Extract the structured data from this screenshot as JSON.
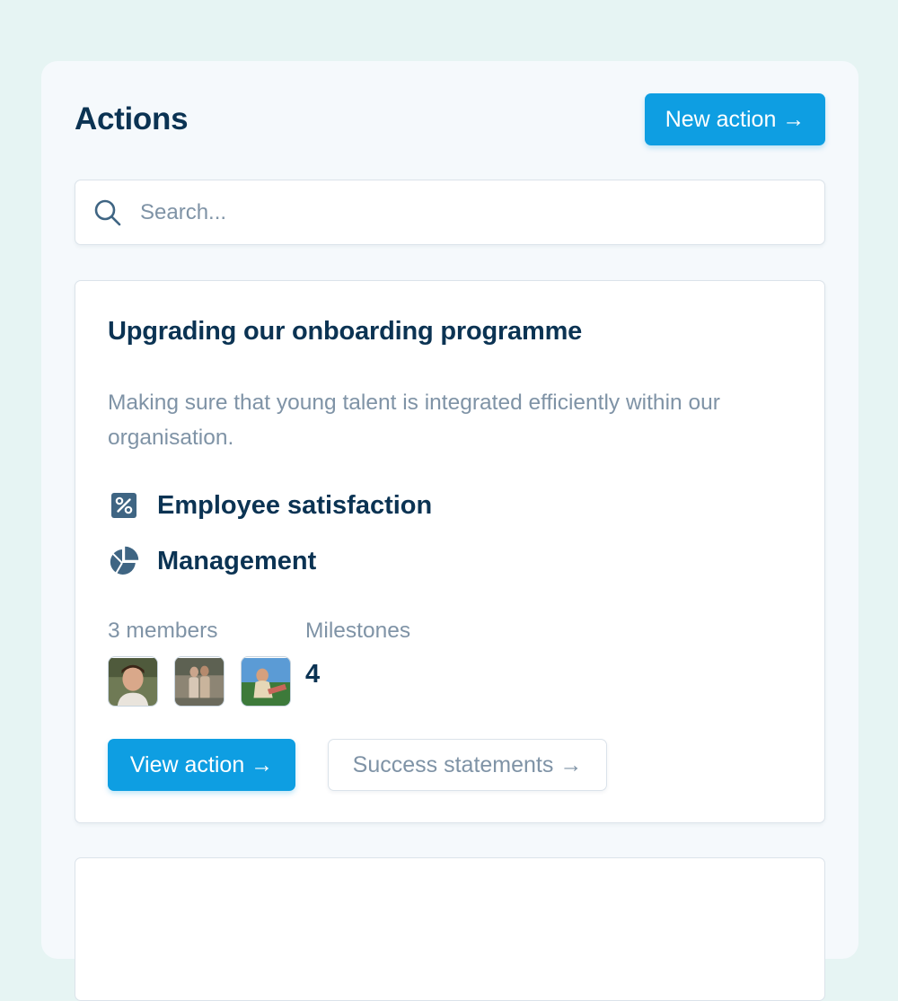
{
  "header": {
    "title": "Actions",
    "new_action_label": "New action →"
  },
  "search": {
    "placeholder": "Search..."
  },
  "action_card": {
    "title": "Upgrading our onboarding programme",
    "description": "Making sure that young talent is integrated efficiently within our organisation.",
    "tags": [
      {
        "label": "Employee satisfaction",
        "icon": "percent-square-icon"
      },
      {
        "label": "Management",
        "icon": "pie-chart-icon"
      }
    ],
    "members_label": "3 members",
    "members": [
      {
        "icon": "member-avatar"
      },
      {
        "icon": "member-avatar"
      },
      {
        "icon": "member-avatar"
      }
    ],
    "milestones_label": "Milestones",
    "milestones_value": "4",
    "view_button_label": "View action →",
    "success_button_label": "Success statements →"
  },
  "colors": {
    "primary": "#0e9ee2",
    "heading": "#0b3353",
    "muted": "#7f93a6",
    "icon": "#3f6583",
    "background": "#e6f4f3"
  }
}
